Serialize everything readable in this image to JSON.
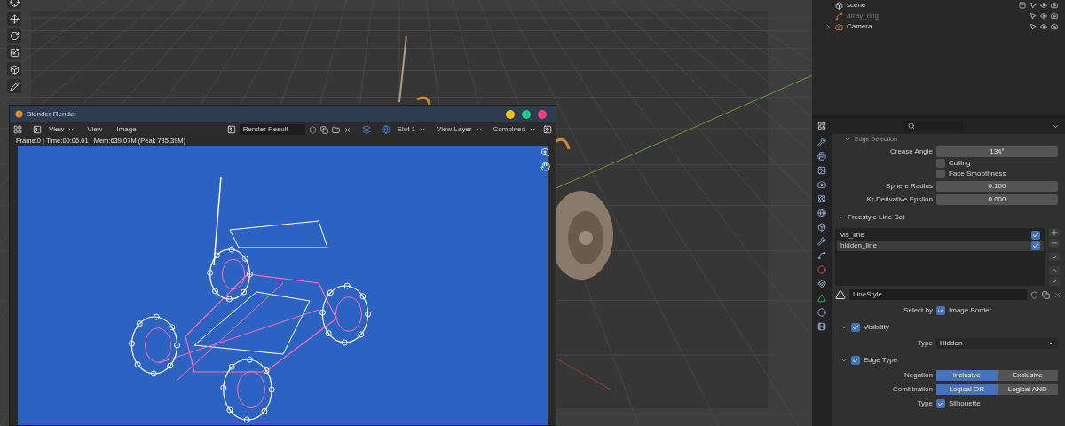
{
  "toolbar": {
    "tools": [
      {
        "kind": "cursor",
        "selected": false
      },
      {
        "kind": "move",
        "selected": false
      },
      {
        "kind": "rotate",
        "selected": false
      },
      {
        "kind": "scale",
        "selected": false
      },
      {
        "kind": "transform",
        "selected": false
      },
      {
        "kind": "annotate",
        "selected": false
      }
    ]
  },
  "render_window": {
    "title": "Blender Render",
    "menus": [
      {
        "label": "View",
        "kind": "dropdown"
      },
      {
        "label": "View",
        "kind": "plain"
      },
      {
        "label": "Image",
        "kind": "plain"
      }
    ],
    "image_name": "Render Result",
    "slot": "Slot 1",
    "layer": "View Layer",
    "pass": "Combined",
    "info": "Frame:0 | Time:00:06.01 | Mem:639.07M (Peak 735.39M)"
  },
  "outliner": {
    "items": [
      {
        "label": "scene",
        "kind": "collection",
        "disabled": false,
        "collapsed": false
      },
      {
        "label": "array_ring",
        "kind": "curve",
        "disabled": true,
        "collapsed": false
      },
      {
        "label": "Camera",
        "kind": "camera",
        "disabled": false,
        "collapsed": true
      }
    ]
  },
  "properties": {
    "rows": [
      {
        "kind": "subheader",
        "label": "Edge Detection",
        "expanded": true
      },
      {
        "kind": "number",
        "label": "Crease Angle",
        "value": "134°"
      },
      {
        "kind": "checkbox",
        "label": "Culling",
        "checked": false
      },
      {
        "kind": "checkbox",
        "label": "Face Smoothness",
        "checked": false
      },
      {
        "kind": "number",
        "label": "Sphere Radius",
        "value": "0.100"
      },
      {
        "kind": "number",
        "label": "Kr Derivative Epsilon",
        "value": "0.000"
      },
      {
        "kind": "panel",
        "label": "Freestyle Line Set",
        "expanded": true
      },
      {
        "kind": "list",
        "items": [
          {
            "label": "vis_line",
            "checked": true,
            "selected": false
          },
          {
            "label": "hidden_line",
            "checked": true,
            "selected": true
          }
        ]
      },
      {
        "kind": "datablock",
        "value": "LineStyle"
      },
      {
        "kind": "labeled_checkbox",
        "label": "Select by",
        "option": "Image Border",
        "checked": true
      },
      {
        "kind": "panel_check",
        "label": "Visibility",
        "expanded": true,
        "checked": true
      },
      {
        "kind": "select",
        "label": "Type",
        "value": "Hidden"
      },
      {
        "kind": "panel_check",
        "label": "Edge Type",
        "expanded": true,
        "checked": true
      },
      {
        "kind": "toggle",
        "label": "Negation",
        "options": [
          {
            "label": "Inclusive",
            "selected": true
          },
          {
            "label": "Exclusive",
            "selected": false
          }
        ]
      },
      {
        "kind": "toggle",
        "label": "Combination",
        "options": [
          {
            "label": "Logical OR",
            "selected": true
          },
          {
            "label": "Logical AND",
            "selected": false
          }
        ]
      },
      {
        "kind": "labeled_checkbox",
        "label": "Type",
        "option": "Silhouette",
        "checked": true
      }
    ]
  }
}
